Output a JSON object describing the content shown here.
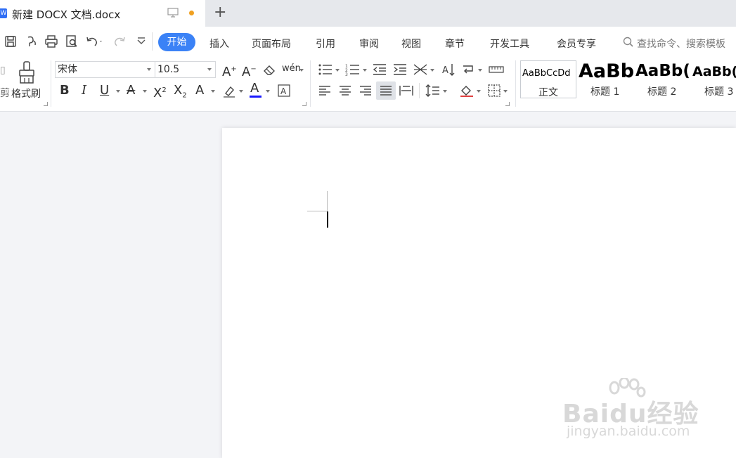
{
  "tab": {
    "title": "新建 DOCX 文档.docx",
    "app_icon_letter": "W"
  },
  "quick_access": [
    "save-icon",
    "format-copy-icon",
    "print-icon",
    "print-preview-icon",
    "undo-icon",
    "redo-icon",
    "more-icon"
  ],
  "menu": {
    "items": [
      "开始",
      "插入",
      "页面布局",
      "引用",
      "审阅",
      "视图",
      "章节",
      "开发工具",
      "会员专享"
    ],
    "active": "开始",
    "search_placeholder": "查找命令、搜索模板"
  },
  "ribbon": {
    "clipboard_fragment": "剪",
    "format_painter_label": "格式刷",
    "font_name": "宋体",
    "font_size": "10.5",
    "pinyin_label": "wén",
    "styles": [
      {
        "sample": "AaBbCcDd",
        "label": "正文"
      },
      {
        "sample": "AaBb",
        "label": "标题 1"
      },
      {
        "sample": "AaBb(",
        "label": "标题 2"
      },
      {
        "sample": "AaBb(",
        "label": "标题 3"
      }
    ]
  },
  "watermark": {
    "brand": "Baidu经验",
    "url": "jingyan.baidu.com"
  },
  "colors": {
    "accent": "#3b82f6",
    "tab_bar": "#e6e8ec",
    "font_color_underline": "#1a1aff",
    "unsaved_dot": "#f0a020"
  }
}
